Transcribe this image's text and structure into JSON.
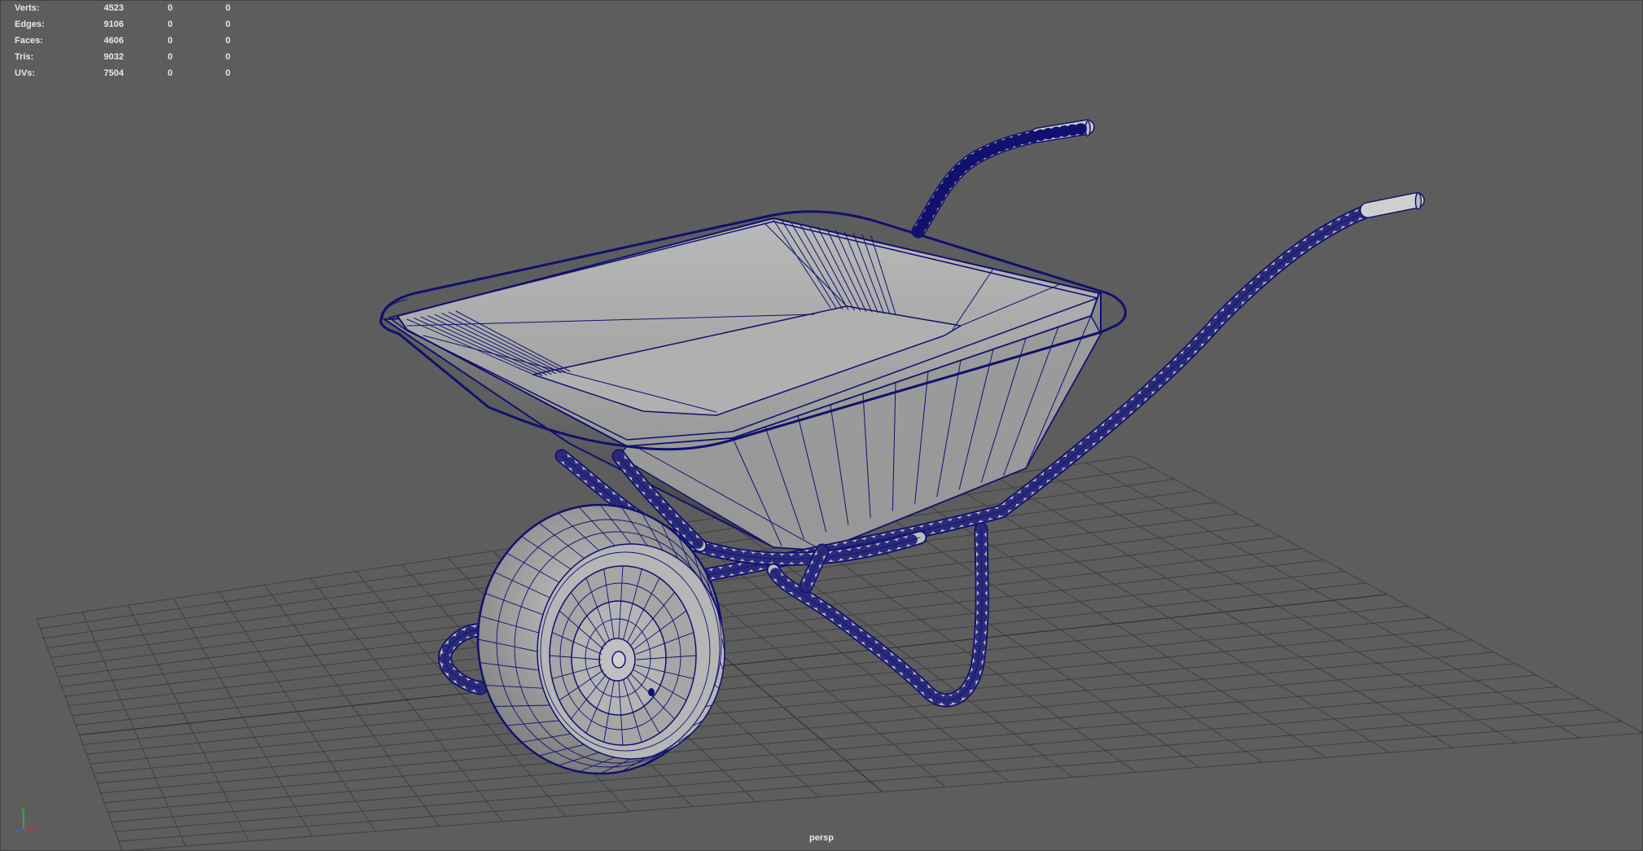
{
  "heads_up_display": {
    "rows": [
      {
        "label": "Verts:",
        "values": [
          "4523",
          "0",
          "0"
        ]
      },
      {
        "label": "Edges:",
        "values": [
          "9106",
          "0",
          "0"
        ]
      },
      {
        "label": "Faces:",
        "values": [
          "4606",
          "0",
          "0"
        ]
      },
      {
        "label": "Tris:",
        "values": [
          "9032",
          "0",
          "0"
        ]
      },
      {
        "label": "UVs:",
        "values": [
          "7504",
          "0",
          "0"
        ]
      }
    ]
  },
  "viewport": {
    "camera": "persp",
    "background_color": "#5d5d5d",
    "wireframe_color": "#10106e",
    "mesh_shading_color": "#a8a8a8",
    "grid_color": "#3f3f3f"
  },
  "axis_gizmo": {
    "x_label": "x",
    "y_label": "y",
    "z_label": "z",
    "x_color": "#d83232",
    "y_color": "#3cb43c",
    "z_color": "#3264e6"
  },
  "scene": {
    "object": "wheelbarrow-icon"
  }
}
